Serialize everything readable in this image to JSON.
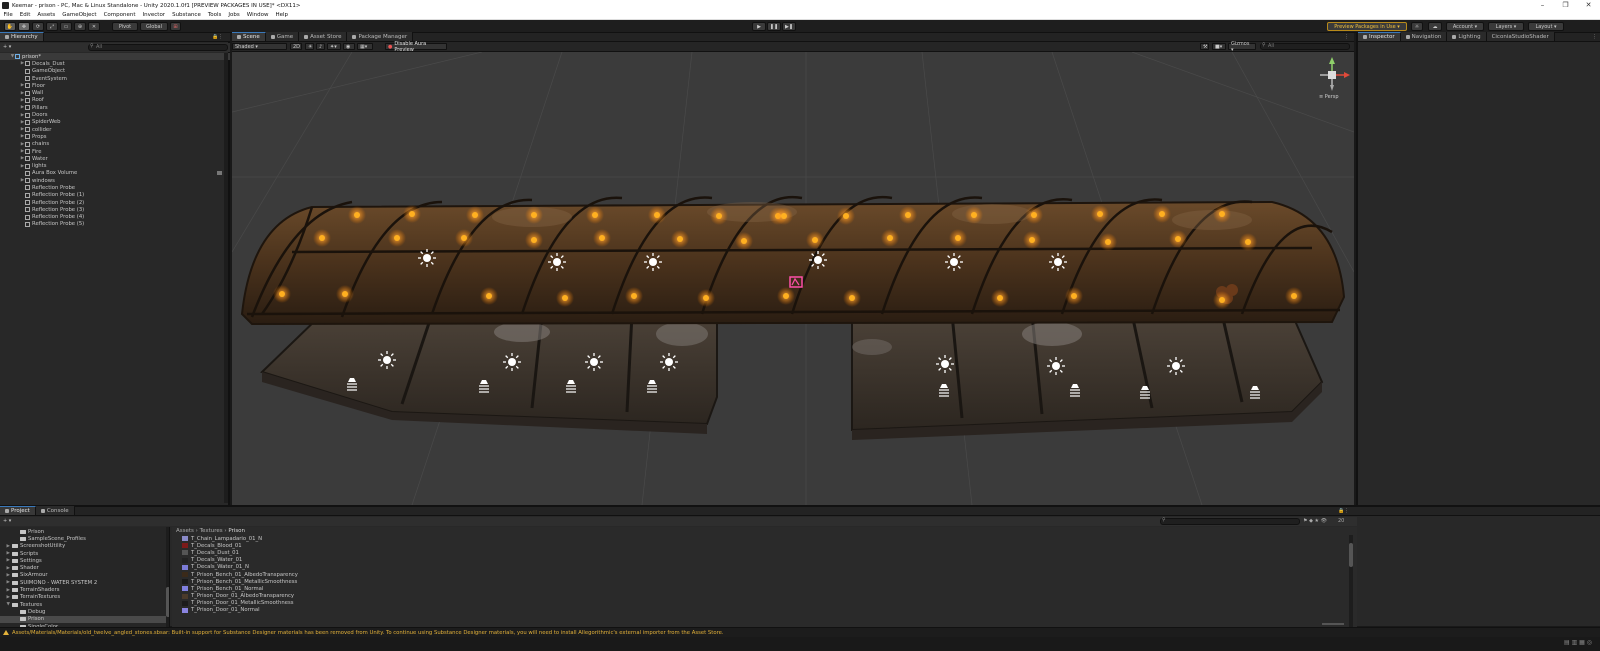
{
  "window": {
    "title": "Keemar - prison - PC, Mac & Linux Standalone - Unity 2020.1.0f1 [PREVIEW PACKAGES IN USE]* <DX11>",
    "controls": [
      "–",
      "❐",
      "✕"
    ]
  },
  "menu": [
    "File",
    "Edit",
    "Assets",
    "GameObject",
    "Component",
    "Invector",
    "Substance",
    "Tools",
    "Jobs",
    "Window",
    "Help"
  ],
  "toolbar": {
    "pivot": "Pivot",
    "global": "Global",
    "play": "▶",
    "pause": "❚❚",
    "step": "▶❚",
    "preview_packages": "Preview Packages in Use ▾",
    "account": "Account ▾",
    "layers": "Layers ▾",
    "layout": "Layout ▾"
  },
  "hierarchy": {
    "tab": "Hierarchy",
    "search_placeholder": "All",
    "root": "prison*",
    "items": [
      {
        "label": "Decals_Dust",
        "expandable": true
      },
      {
        "label": "GameObject",
        "expandable": false
      },
      {
        "label": "EventSystem",
        "expandable": false
      },
      {
        "label": "Floor",
        "expandable": true
      },
      {
        "label": "Wall",
        "expandable": true
      },
      {
        "label": "Roof",
        "expandable": true
      },
      {
        "label": "Pillars",
        "expandable": true
      },
      {
        "label": "Doors",
        "expandable": true
      },
      {
        "label": "SpiderWeb",
        "expandable": true
      },
      {
        "label": "collider",
        "expandable": true
      },
      {
        "label": "Props",
        "expandable": true
      },
      {
        "label": "chains",
        "expandable": true
      },
      {
        "label": "Fire",
        "expandable": true
      },
      {
        "label": "Water",
        "expandable": true
      },
      {
        "label": "lights",
        "expandable": true
      },
      {
        "label": "Aura Box Volume",
        "expandable": false
      },
      {
        "label": "windows",
        "expandable": true
      },
      {
        "label": "Reflection Probe",
        "expandable": false
      },
      {
        "label": "Reflection Probe (1)",
        "expandable": false
      },
      {
        "label": "Reflection Probe (2)",
        "expandable": false
      },
      {
        "label": "Reflection Probe (3)",
        "expandable": false
      },
      {
        "label": "Reflection Probe (4)",
        "expandable": false
      },
      {
        "label": "Reflection Probe (5)",
        "expandable": false
      }
    ]
  },
  "scene_tabs": [
    "Scene",
    "Game",
    "Asset Store",
    "Package Manager"
  ],
  "scene_toolbar": {
    "shading": "Shaded ▾",
    "twod": "2D",
    "aura": "Disable Aura Preview",
    "gizmos": "Gizmos ▾",
    "search_placeholder": "All",
    "persp": "≡ Persp"
  },
  "inspector_tabs": [
    "Inspector",
    "Navigation",
    "Lighting",
    "CiconiaStudioShader"
  ],
  "project": {
    "tabs": [
      "Project",
      "Console"
    ],
    "breadcrumb": [
      "Assets",
      "Textures",
      "Prison"
    ],
    "count": "20",
    "folders": [
      {
        "label": "Prison",
        "indent": 2,
        "selected": false
      },
      {
        "label": "SampleScene_Profiles",
        "indent": 2,
        "selected": false
      },
      {
        "label": "ScreenshotUtility",
        "indent": 1,
        "selected": false
      },
      {
        "label": "Scripts",
        "indent": 1,
        "selected": false
      },
      {
        "label": "Settings",
        "indent": 1,
        "selected": false
      },
      {
        "label": "Shader",
        "indent": 1,
        "selected": false
      },
      {
        "label": "SixArmour",
        "indent": 1,
        "selected": false
      },
      {
        "label": "SUIMONO - WATER SYSTEM 2",
        "indent": 1,
        "selected": false
      },
      {
        "label": "TerrainShaders",
        "indent": 1,
        "selected": false
      },
      {
        "label": "TerrainTextures",
        "indent": 1,
        "selected": false
      },
      {
        "label": "Textures",
        "indent": 1,
        "selected": false
      },
      {
        "label": "Debug",
        "indent": 2,
        "selected": false
      },
      {
        "label": "Prison",
        "indent": 2,
        "selected": true
      },
      {
        "label": "SingleColor",
        "indent": 2,
        "selected": false
      }
    ],
    "assets": [
      {
        "label": "T_Chain_Lampadario_01_N",
        "color": "#8a8ac8"
      },
      {
        "label": "T_Decals_Blood_01",
        "color": "#7a1a1a"
      },
      {
        "label": "T_Decals_Dust_01",
        "color": "#555555"
      },
      {
        "label": "T_Decals_Water_01",
        "color": "#222222"
      },
      {
        "label": "T_Decals_Water_01_N",
        "color": "#7c7cd8"
      },
      {
        "label": "T_Prison_Bench_01_AlbedoTransparency",
        "color": "#3a2a1a"
      },
      {
        "label": "T_Prison_Bench_01_MetallicSmoothness",
        "color": "#1a1a1a"
      },
      {
        "label": "T_Prison_Bench_01_Normal",
        "color": "#8080e0"
      },
      {
        "label": "T_Prison_Door_01_AlbedoTransparency",
        "color": "#4a3a2a"
      },
      {
        "label": "T_Prison_Door_01_MetallicSmoothness",
        "color": "#1c1c1c"
      },
      {
        "label": "T_Prison_Door_01_Normal",
        "color": "#8a84e0"
      }
    ]
  },
  "status": "Assets/Materials/Materials/old_twelve_angled_stones.sbsar: Built-in support for Substance Designer materials has been removed from Unity. To continue using Substance Designer materials, you will need to install Allegorithmic's external importer from the Asset Store."
}
